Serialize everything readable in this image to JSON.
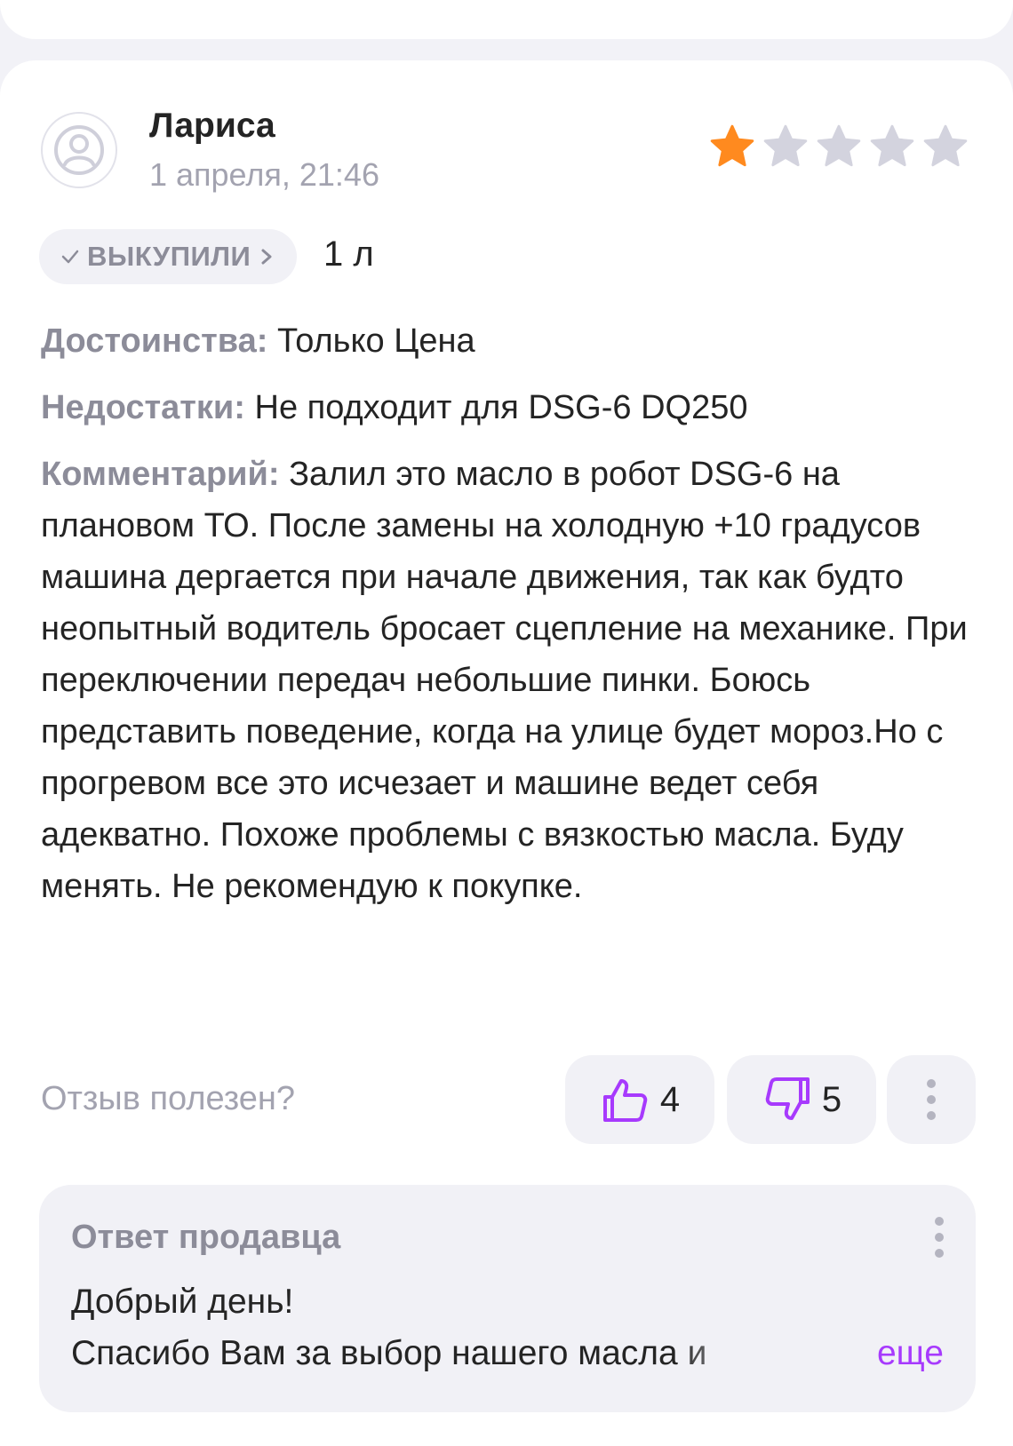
{
  "review": {
    "author": "Лариса",
    "date": "1 апреля, 21:46",
    "rating": 1,
    "max_rating": 5,
    "badge": "ВЫКУПИЛИ",
    "variant": "1 л",
    "pros_label": "Достоинства:",
    "pros": " Только Цена",
    "cons_label": "Недостатки:",
    "cons": " Не подходит для DSG-6 DQ250",
    "comment_label": "Комментарий:",
    "comment": " Залил это масло в робот DSG-6 на плановом ТО. После замены на холодную +10 градусов машина дергается при начале движения, так как будто неопытный водитель бросает сцепление на механике. При переключении передач небольшие пинки. Боюсь представить поведение, когда на улице будет мороз.Но с прогревом все это исчезает и машине ведет себя адекватно. Похоже проблемы с вязкостью масла. Буду менять. Не рекомендую к покупке."
  },
  "feedback": {
    "question": "Отзыв полезен?",
    "likes": "4",
    "dislikes": "5"
  },
  "seller_reply": {
    "title": "Ответ продавца",
    "line1": "Добрый день!",
    "line2": "Спасибо Вам за выбор нашего масла и",
    "more": "еще"
  },
  "colors": {
    "star_active": "#ff8a1f",
    "star_inactive": "#d3d3de",
    "accent": "#a73afd",
    "muted": "#8c8c99"
  },
  "icons": {
    "avatar": "user-circle-icon",
    "star": "star-icon",
    "check": "check-icon",
    "chevron": "chevron-right-icon",
    "like": "thumbs-up-icon",
    "dislike": "thumbs-down-icon",
    "more": "more-vertical-icon"
  }
}
